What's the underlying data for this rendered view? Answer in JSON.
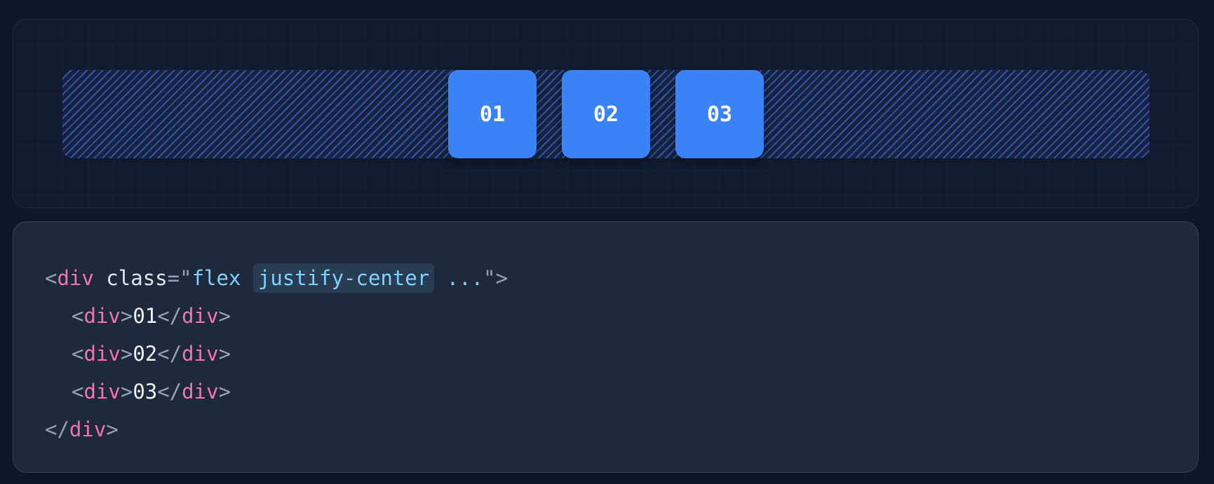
{
  "preview": {
    "items": [
      {
        "label": "01"
      },
      {
        "label": "02"
      },
      {
        "label": "03"
      }
    ]
  },
  "code": {
    "open_lt": "<",
    "open_tag": "div",
    "attr_name": " class",
    "equals": "=",
    "quote_open": "\"",
    "class_flex": "flex ",
    "class_highlight": "justify-center",
    "class_rest": " ...",
    "quote_close": "\"",
    "open_gt": ">",
    "children": [
      {
        "lt": "<",
        "tag": "div",
        "gt": ">",
        "text": "01",
        "close_lt": "</",
        "close_tag": "div",
        "close_gt": ">"
      },
      {
        "lt": "<",
        "tag": "div",
        "gt": ">",
        "text": "02",
        "close_lt": "</",
        "close_tag": "div",
        "close_gt": ">"
      },
      {
        "lt": "<",
        "tag": "div",
        "gt": ">",
        "text": "03",
        "close_lt": "</",
        "close_tag": "div",
        "close_gt": ">"
      }
    ],
    "close_lt": "</",
    "close_tag": "div",
    "close_gt": ">"
  },
  "colors": {
    "background": "#0f172a",
    "item_fill": "#3b82f6",
    "tag": "#f472b6",
    "string": "#7dd3fc",
    "punctuation": "#94a3b8"
  }
}
